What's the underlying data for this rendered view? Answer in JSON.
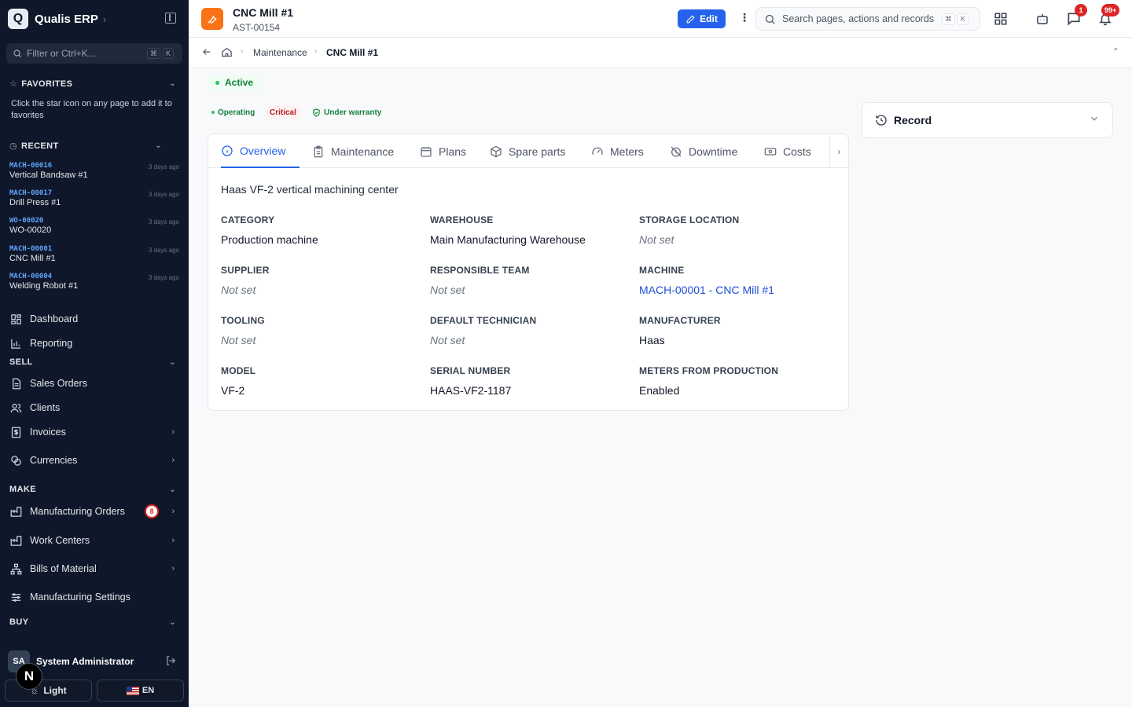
{
  "app": {
    "logo_letter": "Q",
    "name": "Qualis ERP"
  },
  "sidebar": {
    "filter_placeholder": "Filter or Ctrl+K...",
    "filter_keys": [
      "⌘",
      "K"
    ],
    "favorites": {
      "title": "FAVORITES",
      "note": "Click the star icon on any page to add it to favorites"
    },
    "recent": {
      "title": "RECENT",
      "items": [
        {
          "code": "MACH-00016",
          "name": "Vertical Bandsaw #1",
          "time": "3 days ago"
        },
        {
          "code": "MACH-00017",
          "name": "Drill Press #1",
          "time": "3 days ago"
        },
        {
          "code": "WO-00020",
          "name": "WO-00020",
          "time": "3 days ago"
        },
        {
          "code": "MACH-00001",
          "name": "CNC Mill #1",
          "time": "3 days ago"
        },
        {
          "code": "MACH-00004",
          "name": "Welding Robot #1",
          "time": "3 days ago"
        }
      ]
    },
    "top_items": [
      {
        "label": "Dashboard",
        "icon": "dashboard-icon"
      },
      {
        "label": "Reporting",
        "icon": "chart-icon"
      }
    ],
    "sections": [
      {
        "title": "SELL",
        "items": [
          {
            "label": "Sales Orders",
            "icon": "document-icon"
          },
          {
            "label": "Clients",
            "icon": "users-icon"
          },
          {
            "label": "Invoices",
            "icon": "invoice-icon"
          },
          {
            "label": "Currencies",
            "icon": "coins-icon"
          }
        ]
      },
      {
        "title": "MAKE",
        "items": [
          {
            "label": "Manufacturing Orders",
            "icon": "factory-icon",
            "badge": "8"
          },
          {
            "label": "Work Centers",
            "icon": "factory-icon"
          },
          {
            "label": "Bills of Material",
            "icon": "tree-icon"
          },
          {
            "label": "Manufacturing Settings",
            "icon": "sliders-icon"
          }
        ]
      },
      {
        "title": "BUY",
        "items": []
      }
    ],
    "user": {
      "initials": "SA",
      "name": "System Administrator",
      "overlay_letter": "N"
    },
    "theme_label": "Light",
    "language_label": "EN"
  },
  "header": {
    "title": "CNC Mill #1",
    "code": "AST-00154",
    "edit_label": "Edit",
    "search_placeholder": "Search pages, actions and records",
    "search_keys": [
      "⌘",
      "K"
    ],
    "messages_badge": "1",
    "notifications_badge": "99+"
  },
  "breadcrumb": {
    "items": [
      "Maintenance",
      "CNC Mill #1"
    ]
  },
  "status": {
    "label": "Active",
    "color": "#15803d"
  },
  "tags": [
    {
      "label": "Operating",
      "color": "#15803d",
      "bg": "#f0fdf4"
    },
    {
      "label": "Critical",
      "color": "#b91c1c",
      "bg": "#fef2f2"
    },
    {
      "label": "Under warranty",
      "color": "#15803d",
      "bg": "#f0fdf4"
    }
  ],
  "tabs": [
    {
      "label": "Overview",
      "icon": "info-icon",
      "active": true
    },
    {
      "label": "Maintenance",
      "icon": "clipboard-icon"
    },
    {
      "label": "Plans",
      "icon": "calendar-icon"
    },
    {
      "label": "Spare parts",
      "icon": "box-icon"
    },
    {
      "label": "Meters",
      "icon": "gauge-icon"
    },
    {
      "label": "Downtime",
      "icon": "clock-off-icon"
    },
    {
      "label": "Costs",
      "icon": "cash-icon"
    }
  ],
  "overview": {
    "description": "Haas VF-2 vertical machining center",
    "fields": [
      {
        "label": "CATEGORY",
        "value": "Production machine"
      },
      {
        "label": "WAREHOUSE",
        "value": "Main Manufacturing Warehouse"
      },
      {
        "label": "STORAGE LOCATION",
        "value": "Not set",
        "empty": true
      },
      {
        "label": "SUPPLIER",
        "value": "Not set",
        "empty": true
      },
      {
        "label": "RESPONSIBLE TEAM",
        "value": "Not set",
        "empty": true
      },
      {
        "label": "MACHINE",
        "value": "MACH-00001 - CNC Mill #1",
        "link": true
      },
      {
        "label": "TOOLING",
        "value": "Not set",
        "empty": true
      },
      {
        "label": "DEFAULT TECHNICIAN",
        "value": "Not set",
        "empty": true
      },
      {
        "label": "MANUFACTURER",
        "value": "Haas"
      },
      {
        "label": "MODEL",
        "value": "VF-2"
      },
      {
        "label": "SERIAL NUMBER",
        "value": "HAAS-VF2-1187"
      },
      {
        "label": "METERS FROM PRODUCTION",
        "value": "Enabled"
      }
    ]
  },
  "record_panel": {
    "title": "Record"
  },
  "colors": {
    "sidebar_bg": "#0f172a",
    "accent": "#2563eb",
    "asset_icon": "#f97316",
    "danger": "#dc2626"
  }
}
